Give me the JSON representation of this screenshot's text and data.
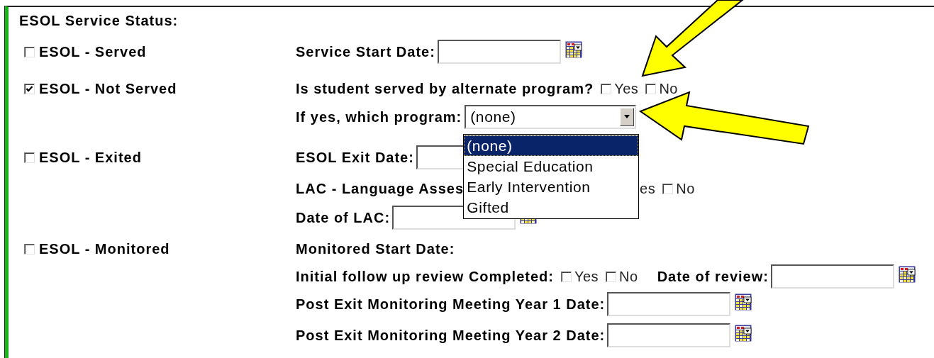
{
  "section_title": "ESOL Service Status:",
  "rows": [
    {
      "status": {
        "label": "ESOL - Served",
        "checked": false
      },
      "items": [
        {
          "kind": "label",
          "text": "Service Start Date:"
        },
        {
          "kind": "date",
          "calendar": true
        }
      ]
    },
    {
      "status": {
        "label": "ESOL - Not Served",
        "checked": true
      },
      "items": [
        {
          "kind": "label",
          "text": "Is student served by alternate program?"
        },
        {
          "kind": "checkbox",
          "label": "Yes",
          "checked": false
        },
        {
          "kind": "checkbox",
          "label": "No",
          "checked": false
        }
      ]
    },
    {
      "items": [
        {
          "kind": "label",
          "text": "If yes, which program:"
        },
        {
          "kind": "select",
          "value": "(none)",
          "expanded": true,
          "options": [
            {
              "label": "(none)",
              "selected": true
            },
            {
              "label": "Special Education",
              "selected": false
            },
            {
              "label": "Early Intervention",
              "selected": false
            },
            {
              "label": "Gifted",
              "selected": false
            }
          ]
        }
      ]
    },
    {
      "status": {
        "label": "ESOL - Exited",
        "checked": false
      },
      "items": [
        {
          "kind": "label",
          "text": "ESOL Exit Date:"
        },
        {
          "kind": "date",
          "calendar": false
        }
      ]
    },
    {
      "items": [
        {
          "kind": "label",
          "text": "LAC - Language Asses"
        },
        {
          "kind": "partial",
          "text": "es"
        },
        {
          "kind": "checkbox",
          "label": "No",
          "checked": false
        }
      ]
    },
    {
      "items": [
        {
          "kind": "label",
          "text": "Date of LAC:"
        },
        {
          "kind": "date",
          "calendar": true
        }
      ]
    },
    {
      "status": {
        "label": "ESOL - Monitored",
        "checked": false
      },
      "items": [
        {
          "kind": "label",
          "text": "Monitored Start Date:"
        }
      ]
    },
    {
      "items": [
        {
          "kind": "label",
          "text": "Initial follow up review Completed:"
        },
        {
          "kind": "checkbox",
          "label": "Yes",
          "checked": false
        },
        {
          "kind": "checkbox",
          "label": "No",
          "checked": false
        },
        {
          "kind": "label",
          "text": "Date of review:"
        },
        {
          "kind": "date",
          "calendar": true
        }
      ]
    },
    {
      "items": [
        {
          "kind": "label",
          "text": "Post Exit Monitoring Meeting Year 1 Date:"
        },
        {
          "kind": "date",
          "calendar": true
        }
      ]
    },
    {
      "items": [
        {
          "kind": "label",
          "text": "Post Exit Monitoring Meeting Year 2 Date:"
        },
        {
          "kind": "date",
          "calendar": true
        }
      ]
    }
  ]
}
